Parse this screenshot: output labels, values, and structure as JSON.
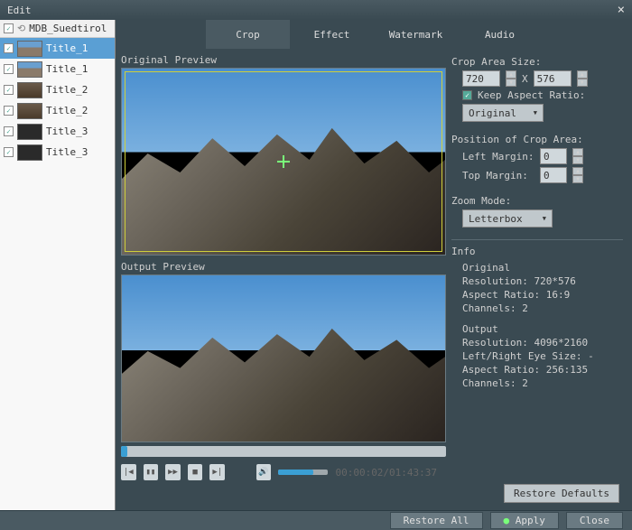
{
  "window": {
    "title": "Edit"
  },
  "sidebar": {
    "root_label": "MDB_Suedtirol",
    "items": [
      {
        "label": "Title_1",
        "selected": true,
        "thumb": "mtn"
      },
      {
        "label": "Title_1",
        "thumb": "mtn"
      },
      {
        "label": "Title_2",
        "thumb": "brown"
      },
      {
        "label": "Title_2",
        "thumb": "brown"
      },
      {
        "label": "Title_3",
        "thumb": "dark"
      },
      {
        "label": "Title_3",
        "thumb": "dark"
      }
    ]
  },
  "tabs": [
    {
      "label": "Crop",
      "active": true
    },
    {
      "label": "Effect"
    },
    {
      "label": "Watermark"
    },
    {
      "label": "Audio"
    }
  ],
  "preview": {
    "original_label": "Original Preview",
    "output_label": "Output Preview",
    "progress_pct": 2,
    "timecode": "00:00:02/01:43:37"
  },
  "crop": {
    "size_label": "Crop Area Size:",
    "width": "720",
    "x": "X",
    "height": "576",
    "keep_ratio_label": "Keep Aspect Ratio:",
    "ratio_select": "Original",
    "position_label": "Position of Crop Area:",
    "left_label": "Left Margin:",
    "left_value": "0",
    "top_label": "Top Margin:",
    "top_value": "0",
    "zoom_label": "Zoom Mode:",
    "zoom_select": "Letterbox"
  },
  "info": {
    "title": "Info",
    "original_label": "Original",
    "orig_resolution": "Resolution: 720*576",
    "orig_aspect": "Aspect Ratio: 16:9",
    "orig_channels": "Channels: 2",
    "output_label": "Output",
    "out_resolution": "Resolution: 4096*2160",
    "out_eye": "Left/Right Eye Size: -",
    "out_aspect": "Aspect Ratio: 256:135",
    "out_channels": "Channels: 2"
  },
  "buttons": {
    "restore_defaults": "Restore Defaults",
    "restore_all": "Restore All",
    "apply": "Apply",
    "close": "Close"
  }
}
